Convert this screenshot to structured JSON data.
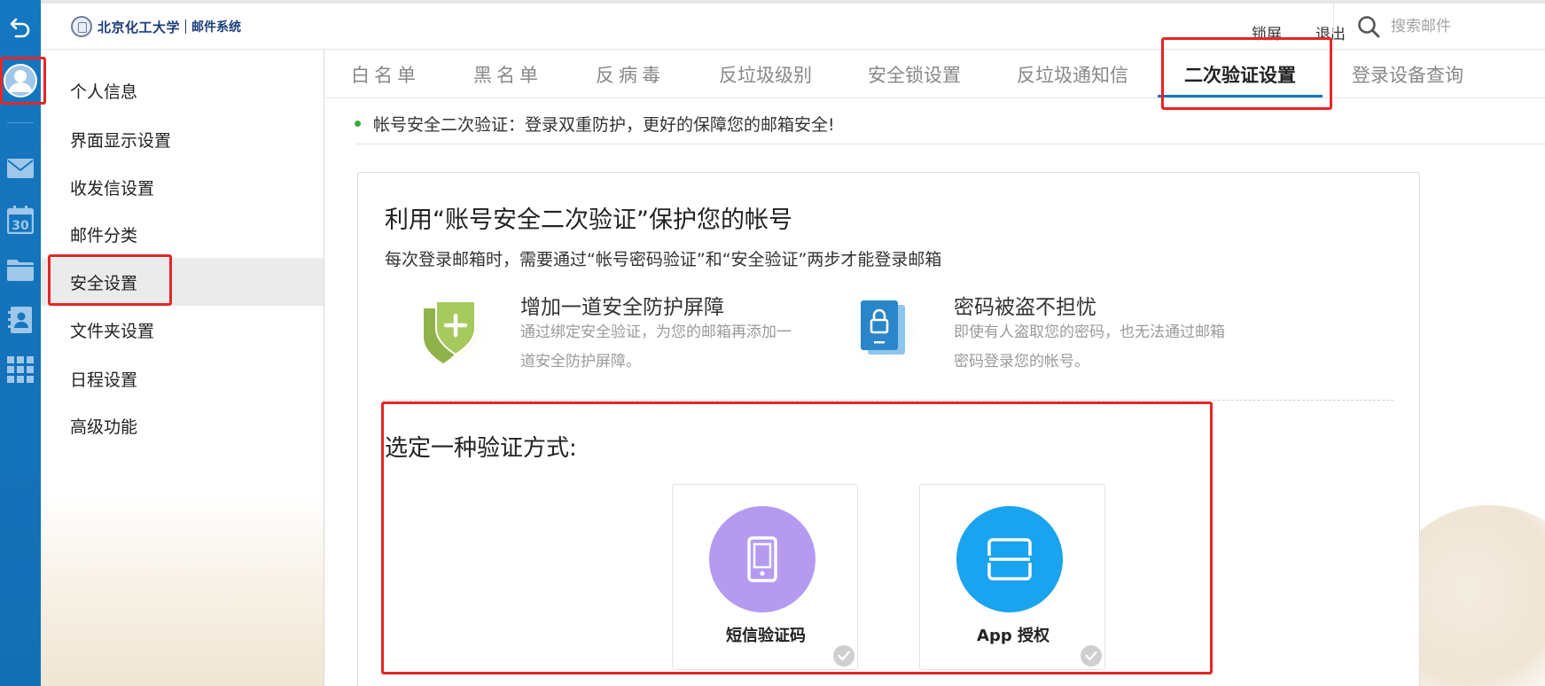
{
  "header": {
    "logo_text": "北京化工大学",
    "logo_system": "邮件系统",
    "lock_label": "锁屏",
    "logout_label": "退出",
    "search_placeholder": "搜索邮件"
  },
  "rail": {
    "icons": [
      "back-icon",
      "avatar-icon",
      "mail-icon",
      "calendar-icon",
      "folder-icon",
      "contacts-icon",
      "apps-grid-icon"
    ],
    "calendar_day": "30"
  },
  "sidebar": {
    "items": [
      {
        "label": "个人信息"
      },
      {
        "label": "界面显示设置"
      },
      {
        "label": "收发信设置"
      },
      {
        "label": "邮件分类"
      },
      {
        "label": "安全设置",
        "active": true
      },
      {
        "label": "文件夹设置"
      },
      {
        "label": "日程设置"
      },
      {
        "label": "高级功能"
      }
    ]
  },
  "tabs": [
    {
      "label": "白名单"
    },
    {
      "label": "黑名单"
    },
    {
      "label": "反病毒"
    },
    {
      "label": "反垃圾级别"
    },
    {
      "label": "安全锁设置"
    },
    {
      "label": "反垃圾通知信"
    },
    {
      "label": "二次验证设置",
      "active": true
    },
    {
      "label": "登录设备查询"
    }
  ],
  "main": {
    "notice": "帐号安全二次验证：登录双重防护，更好的保障您的邮箱安全!",
    "card_title": "利用“账号安全二次验证”保护您的帐号",
    "card_desc": "每次登录邮箱时，需要通过“帐号密码验证”和“安全验证”两步才能登录邮箱",
    "features": [
      {
        "title": "增加一道安全防护屏障",
        "text_line1": "通过绑定安全验证，为您的邮箱再添加一",
        "text_line2": "道安全防护屏障。",
        "icon": "shield-plus-icon"
      },
      {
        "title": "密码被盗不担忧",
        "text_line1": "即使有人盗取您的密码，也无法通过邮箱",
        "text_line2": "密码登录您的帐号。",
        "icon": "lock-document-icon"
      }
    ],
    "choose_label": "选定一种验证方式:",
    "methods": [
      {
        "label": "短信验证码",
        "icon": "phone-icon",
        "color": "#b49bf0"
      },
      {
        "label": "App 授权",
        "icon": "scan-icon",
        "color": "#1aa3ee"
      }
    ]
  },
  "colors": {
    "rail": "#1577c0",
    "accent": "#1577c0",
    "highlight": "#e52626",
    "notice_dot": "#3aa93a"
  }
}
